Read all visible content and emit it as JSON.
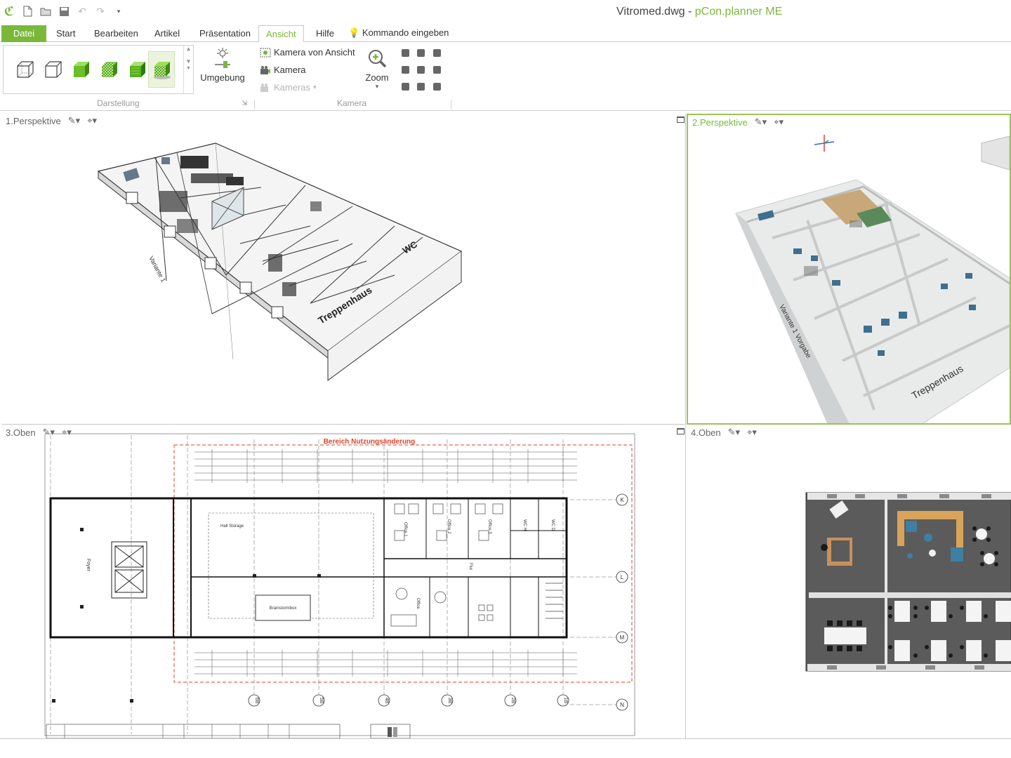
{
  "window": {
    "file": "Vitromed.dwg",
    "separator": " - ",
    "app": "pCon.planner ME"
  },
  "qat": {
    "logo_icon": "app-logo-icon",
    "new_icon": "new-file-icon",
    "open_icon": "open-folder-icon",
    "save_icon": "save-icon",
    "undo_icon": "undo-icon",
    "redo_icon": "redo-icon",
    "customize_icon": "customize-qat-icon"
  },
  "menu": {
    "file": "Datei",
    "start": "Start",
    "edit": "Bearbeiten",
    "article": "Artikel",
    "presentation": "Präsentation",
    "view": "Ansicht",
    "help": "Hilfe",
    "command": "Kommando eingeben"
  },
  "ribbon": {
    "environment": "Umgebung",
    "camera_from_view": "Kamera von Ansicht",
    "camera": "Kamera",
    "cameras": "Kameras",
    "zoom": "Zoom",
    "group_display": "Darstellung",
    "group_camera": "Kamera"
  },
  "viewports": {
    "vp1": "1.Perspektive",
    "vp2": "2.Perspektive",
    "vp3": "3.Oben",
    "vp4": "4.Oben"
  },
  "scene": {
    "variant1": "Variante 1",
    "variant1_default": "Variante 1 Vorgabe",
    "stairwell": "Treppenhaus",
    "wc": "WC"
  },
  "plan": {
    "area_title": "Bereich Nutzungsänderung",
    "room_hall": "Hall\nStorage",
    "room_foyer": "Foyer",
    "room_brainstorm": "Brainstormbox",
    "room_floor": "Flur",
    "office1": "Office 1",
    "office2": "Office 2",
    "office3": "Office 3",
    "wc_h": "WC H",
    "wc_d": "WC D",
    "office_d": "Office",
    "axes_right": [
      "K",
      "L",
      "M",
      "N"
    ],
    "axes_bottom": [
      "6B",
      "5B",
      "4B",
      "3B",
      "2B",
      "1B"
    ]
  },
  "colors": {
    "accent": "#7ab83a",
    "active_border": "#9dc356",
    "plan_red": "#e0432a"
  }
}
